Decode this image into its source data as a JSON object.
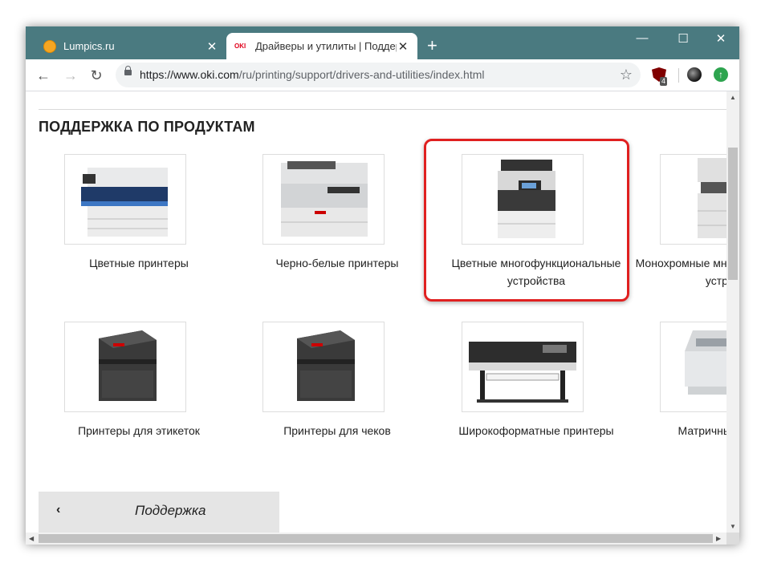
{
  "tabs": [
    {
      "title": "Lumpics.ru",
      "favicon": "lumpics-orange-icon",
      "active": false
    },
    {
      "title": "Драйверы и утилиты | Поддержка",
      "favicon_text": "OKI",
      "active": true
    }
  ],
  "toolbar": {
    "url_host": "https://www.oki.com",
    "url_path": "/ru/printing/support/drivers-and-utilities/index.html",
    "extension_badge": "4"
  },
  "page": {
    "heading": "ПОДДЕРЖКА ПО ПРОДУКТАМ",
    "categories_row1": [
      {
        "label": "Цветные принтеры",
        "icon": "color-printer"
      },
      {
        "label": "Черно-белые принтеры",
        "icon": "mono-printer"
      },
      {
        "label": "Цветные многофункциональные устройства",
        "icon": "color-mfp",
        "highlighted": true
      },
      {
        "label": "Монохромные многофункциональные устройства",
        "icon": "mono-mfp"
      }
    ],
    "categories_row2": [
      {
        "label": "Принтеры для этикеток",
        "icon": "label-printer"
      },
      {
        "label": "Принтеры для чеков",
        "icon": "receipt-printer"
      },
      {
        "label": "Широкоформатные принтеры",
        "icon": "wide-format-printer"
      },
      {
        "label": "Матричные принтеры",
        "icon": "dot-matrix-printer"
      }
    ],
    "support_button": "Поддержка"
  },
  "colors": {
    "tab_strip": "#4a7a80",
    "highlight": "#e02020"
  }
}
